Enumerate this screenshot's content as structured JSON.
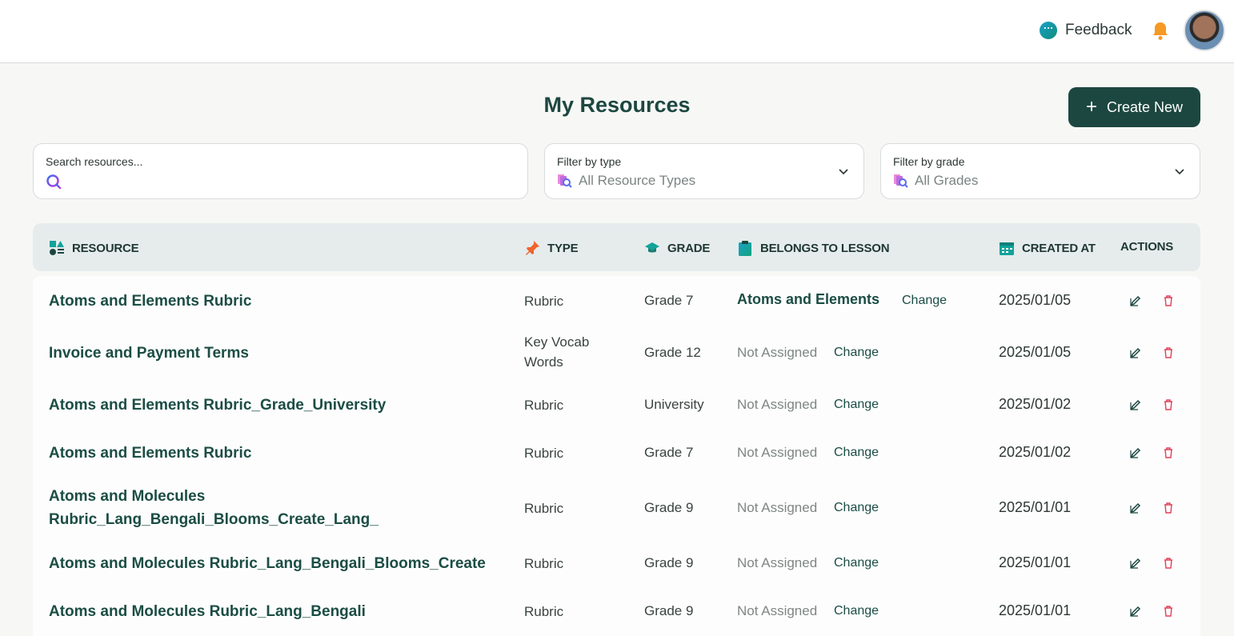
{
  "header": {
    "feedback_label": "Feedback"
  },
  "page": {
    "title": "My Resources",
    "create_label": "Create New"
  },
  "filters": {
    "search_label": "Search resources...",
    "search_value": "",
    "type_label": "Filter by type",
    "type_value": "All Resource Types",
    "grade_label": "Filter by grade",
    "grade_value": "All Grades"
  },
  "table": {
    "columns": {
      "resource": "RESOURCE",
      "type": "TYPE",
      "grade": "GRADE",
      "lesson": "BELONGS TO LESSON",
      "created": "CREATED AT",
      "actions": "ACTIONS"
    },
    "change_label": "Change",
    "rows": [
      {
        "name": "Atoms and Elements Rubric",
        "type": "Rubric",
        "grade": "Grade 7",
        "lesson": "Atoms and Elements",
        "assigned": true,
        "created": "2025/01/05"
      },
      {
        "name": "Invoice and Payment Terms",
        "type": "Key Vocab Words",
        "grade": "Grade 12",
        "lesson": "Not Assigned",
        "assigned": false,
        "created": "2025/01/05"
      },
      {
        "name": "Atoms and Elements Rubric_Grade_University",
        "type": "Rubric",
        "grade": "University",
        "lesson": "Not Assigned",
        "assigned": false,
        "created": "2025/01/02"
      },
      {
        "name": "Atoms and Elements Rubric",
        "type": "Rubric",
        "grade": "Grade 7",
        "lesson": "Not Assigned",
        "assigned": false,
        "created": "2025/01/02"
      },
      {
        "name": "Atoms and Molecules Rubric_Lang_Bengali_Blooms_Create_Lang_",
        "type": "Rubric",
        "grade": "Grade 9",
        "lesson": "Not Assigned",
        "assigned": false,
        "created": "2025/01/01"
      },
      {
        "name": "Atoms and Molecules Rubric_Lang_Bengali_Blooms_Create",
        "type": "Rubric",
        "grade": "Grade 9",
        "lesson": "Not Assigned",
        "assigned": false,
        "created": "2025/01/01"
      },
      {
        "name": "Atoms and Molecules Rubric_Lang_Bengali",
        "type": "Rubric",
        "grade": "Grade 9",
        "lesson": "Not Assigned",
        "assigned": false,
        "created": "2025/01/01"
      }
    ]
  },
  "colors": {
    "brand": "#1c4740",
    "accent_teal": "#12a39a",
    "danger": "#e0405a",
    "bell": "#f59a23"
  },
  "icons": {
    "feedback": "chat-bubble-icon",
    "bell": "bell-icon",
    "search": "magnifier-icon",
    "edit": "edit-icon",
    "delete": "trash-icon"
  }
}
